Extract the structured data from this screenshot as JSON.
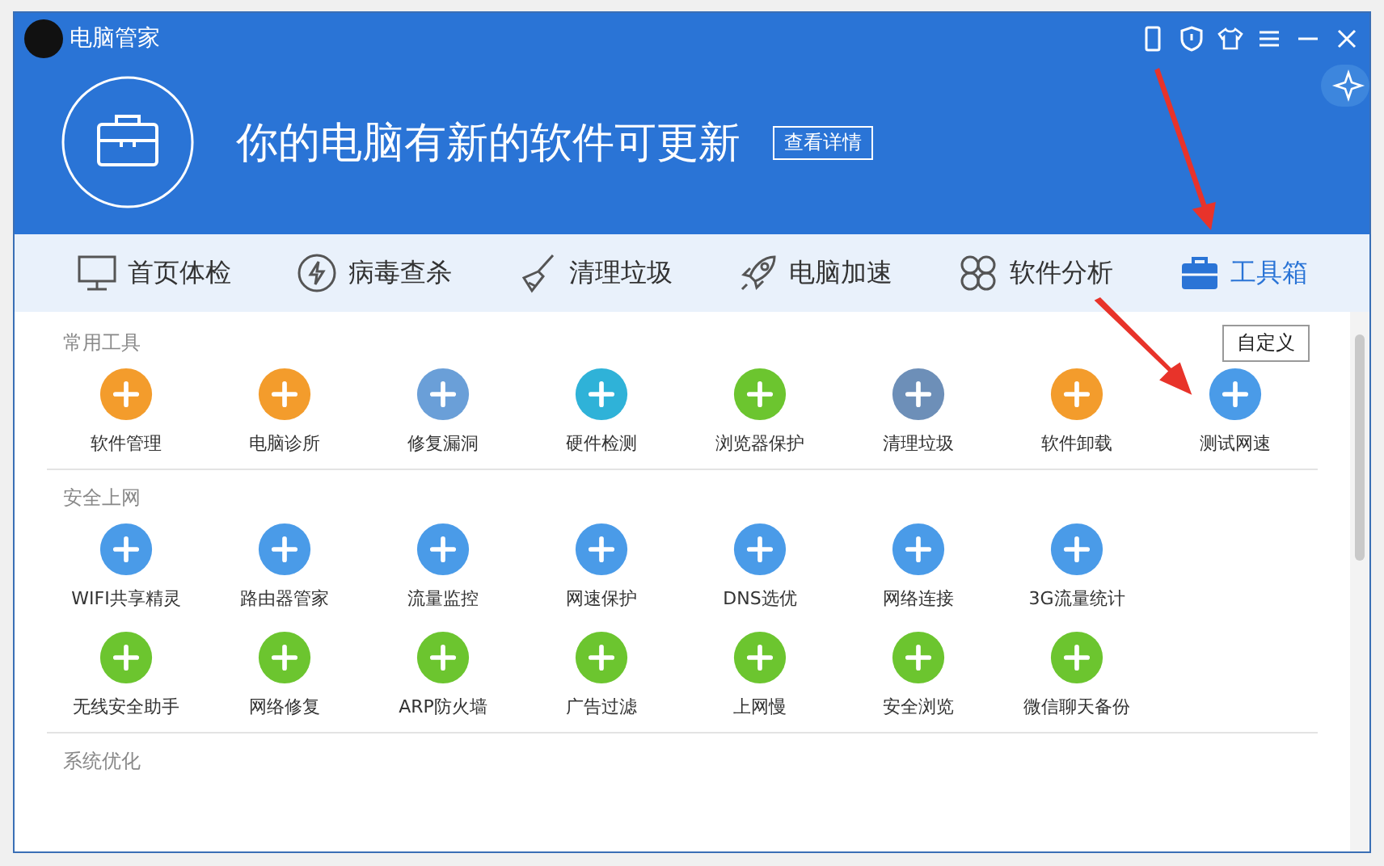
{
  "window": {
    "title": "电脑管家"
  },
  "banner": {
    "message": "你的电脑有新的软件可更新",
    "button": "查看详情"
  },
  "tabs": [
    {
      "label": "首页体检",
      "selected": false
    },
    {
      "label": "病毒查杀",
      "selected": false
    },
    {
      "label": "清理垃圾",
      "selected": false
    },
    {
      "label": "电脑加速",
      "selected": false
    },
    {
      "label": "软件分析",
      "selected": false
    },
    {
      "label": "工具箱",
      "selected": true
    }
  ],
  "customize_button": "自定义",
  "sections": [
    {
      "title": "常用工具",
      "rows": [
        [
          {
            "label": "软件管理",
            "color": "#f39c2c"
          },
          {
            "label": "电脑诊所",
            "color": "#f39c2c"
          },
          {
            "label": "修复漏洞",
            "color": "#6a9fd8"
          },
          {
            "label": "硬件检测",
            "color": "#2fb2d8"
          },
          {
            "label": "浏览器保护",
            "color": "#6cc52f"
          },
          {
            "label": "清理垃圾",
            "color": "#6d8fb8"
          },
          {
            "label": "软件卸载",
            "color": "#f39c2c"
          },
          {
            "label": "测试网速",
            "color": "#4a9be8"
          }
        ]
      ]
    },
    {
      "title": "安全上网",
      "rows": [
        [
          {
            "label": "WIFI共享精灵",
            "color": "#4a9be8"
          },
          {
            "label": "路由器管家",
            "color": "#4a9be8"
          },
          {
            "label": "流量监控",
            "color": "#4a9be8"
          },
          {
            "label": "网速保护",
            "color": "#4a9be8"
          },
          {
            "label": "DNS选优",
            "color": "#4a9be8"
          },
          {
            "label": "网络连接",
            "color": "#4a9be8"
          },
          {
            "label": "3G流量统计",
            "color": "#4a9be8"
          }
        ],
        [
          {
            "label": "无线安全助手",
            "color": "#6cc52f"
          },
          {
            "label": "网络修复",
            "color": "#6cc52f"
          },
          {
            "label": "ARP防火墙",
            "color": "#6cc52f"
          },
          {
            "label": "广告过滤",
            "color": "#6cc52f"
          },
          {
            "label": "上网慢",
            "color": "#6cc52f"
          },
          {
            "label": "安全浏览",
            "color": "#6cc52f"
          },
          {
            "label": "微信聊天备份",
            "color": "#6cc52f"
          }
        ]
      ]
    },
    {
      "title": "系统优化"
    }
  ]
}
